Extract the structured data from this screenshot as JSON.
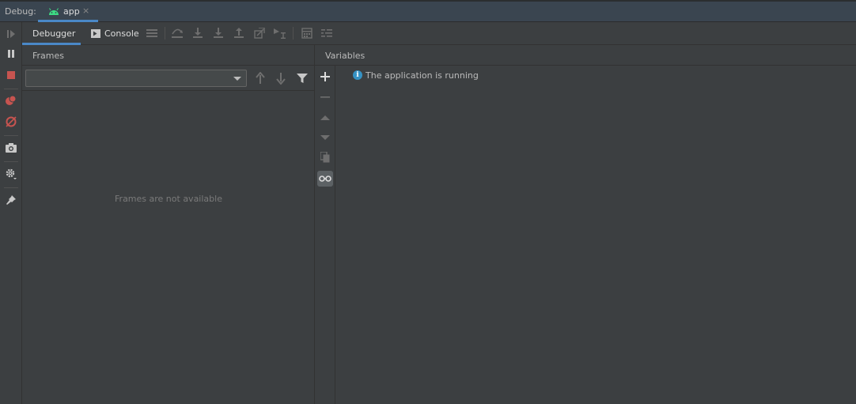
{
  "window": {
    "debug_label": "Debug:",
    "run_tab_label": "app",
    "run_tab_close": "×"
  },
  "tabs": [
    {
      "label": "Debugger",
      "active": true
    },
    {
      "label": "Console",
      "active": false
    }
  ],
  "frames": {
    "title": "Frames",
    "thread_select_value": "",
    "empty_text": "Frames are not available"
  },
  "variables": {
    "title": "Variables",
    "status_text": "The application is running",
    "status_icon": "i"
  },
  "icons": {
    "left_toolbar": [
      "resume-icon",
      "pause-icon",
      "stop-icon",
      "view-breakpoints-icon",
      "mute-breakpoints-icon",
      "camera-icon",
      "settings-icon",
      "pin-icon"
    ],
    "top_toolbar": [
      "show-execution-point-icon",
      "step-over-icon",
      "step-into-icon",
      "force-step-into-icon",
      "step-out-icon",
      "drop-frame-icon",
      "run-to-cursor-icon",
      "evaluate-expression-icon",
      "trace-icon"
    ],
    "frames_toolbar": [
      "previous-frame-icon",
      "next-frame-icon",
      "filter-icon"
    ],
    "variables_strip": [
      "add-icon",
      "remove-icon",
      "move-up-icon",
      "move-down-icon",
      "duplicate-icon",
      "watches-icon"
    ]
  },
  "colors": {
    "accent": "#4a88c7",
    "stop_red": "#c75450",
    "android_green": "#3ddc84",
    "info_blue": "#3592c4"
  }
}
